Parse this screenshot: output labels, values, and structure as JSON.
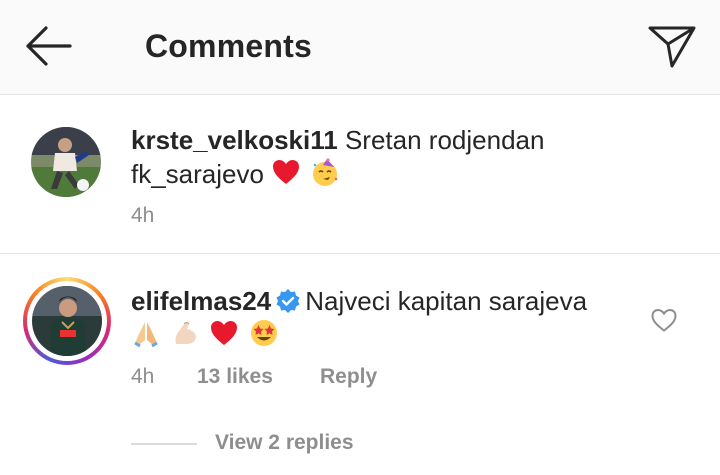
{
  "header": {
    "title": "Comments",
    "back_icon": "arrow-left-icon",
    "send_icon": "paper-plane-icon"
  },
  "comments": [
    {
      "username": "krste_velkoski11",
      "text_line1": "Sretan rodjendan",
      "text_line2": "fk_sarajevo",
      "emojis": [
        "red-heart-emoji",
        "partying-face-emoji"
      ],
      "time": "4h"
    },
    {
      "username": "elifelmas24",
      "verified": true,
      "text": "Najveci kapitan sarajeva",
      "emojis": [
        "folded-hands-emoji",
        "flexed-biceps-emoji",
        "red-heart-emoji",
        "star-struck-emoji"
      ],
      "time": "4h",
      "likes": "13 likes",
      "reply_label": "Reply",
      "view_replies": "View 2 replies",
      "has_story_ring": true
    }
  ],
  "colors": {
    "text": "#262626",
    "secondary": "#8e8e8e",
    "verified": "#3897f0",
    "heart": "#ed4956"
  }
}
